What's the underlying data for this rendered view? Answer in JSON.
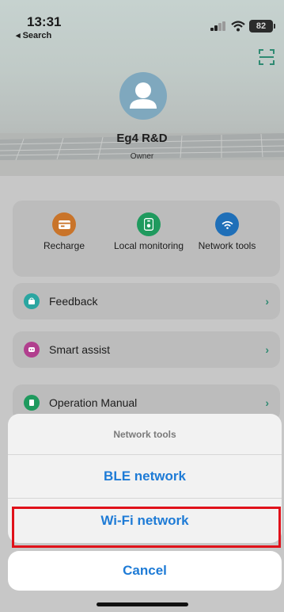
{
  "status_bar": {
    "time": "13:31",
    "back": "◂ Search",
    "battery": "82"
  },
  "profile": {
    "name": "Eg4 R&D",
    "role": "Owner"
  },
  "quick_actions": [
    {
      "label": "Recharge",
      "icon": "card-icon",
      "color": "#c9742a"
    },
    {
      "label": "Local monitoring",
      "icon": "monitor-device-icon",
      "color": "#1f9a5e"
    },
    {
      "label": "Network tools",
      "icon": "wifi-signal-icon",
      "color": "#1f6fb8"
    }
  ],
  "menu": [
    {
      "label": "Feedback",
      "icon": "feedback-icon",
      "color": "#2aa6a1"
    },
    {
      "label": "Smart assist",
      "icon": "assist-icon",
      "color": "#b13f8e"
    },
    {
      "label": "Operation Manual",
      "icon": "manual-icon",
      "color": "#1f9a5e"
    }
  ],
  "action_sheet": {
    "title": "Network tools",
    "options": [
      "BLE network",
      "Wi-Fi network"
    ],
    "cancel": "Cancel",
    "highlighted": "Wi-Fi network",
    "highlight_color": "#e0111a"
  },
  "colors": {
    "accent": "#1e7bd6",
    "chevron": "#2f8a72"
  }
}
